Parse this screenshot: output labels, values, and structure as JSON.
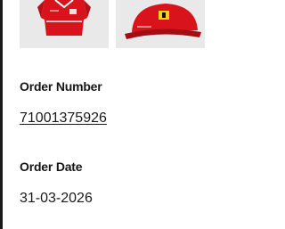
{
  "order": {
    "items": [
      {
        "icon": "red-team-shirt-image"
      },
      {
        "icon": "red-team-cap-image"
      }
    ],
    "number_label": "Order Number",
    "number_value": "71001375926",
    "date_label": "Order Date",
    "date_value": "31-03-2026"
  },
  "colors": {
    "product_red": "#d8131b",
    "thumb_bg": "#e9e9e9",
    "text": "#181818"
  }
}
